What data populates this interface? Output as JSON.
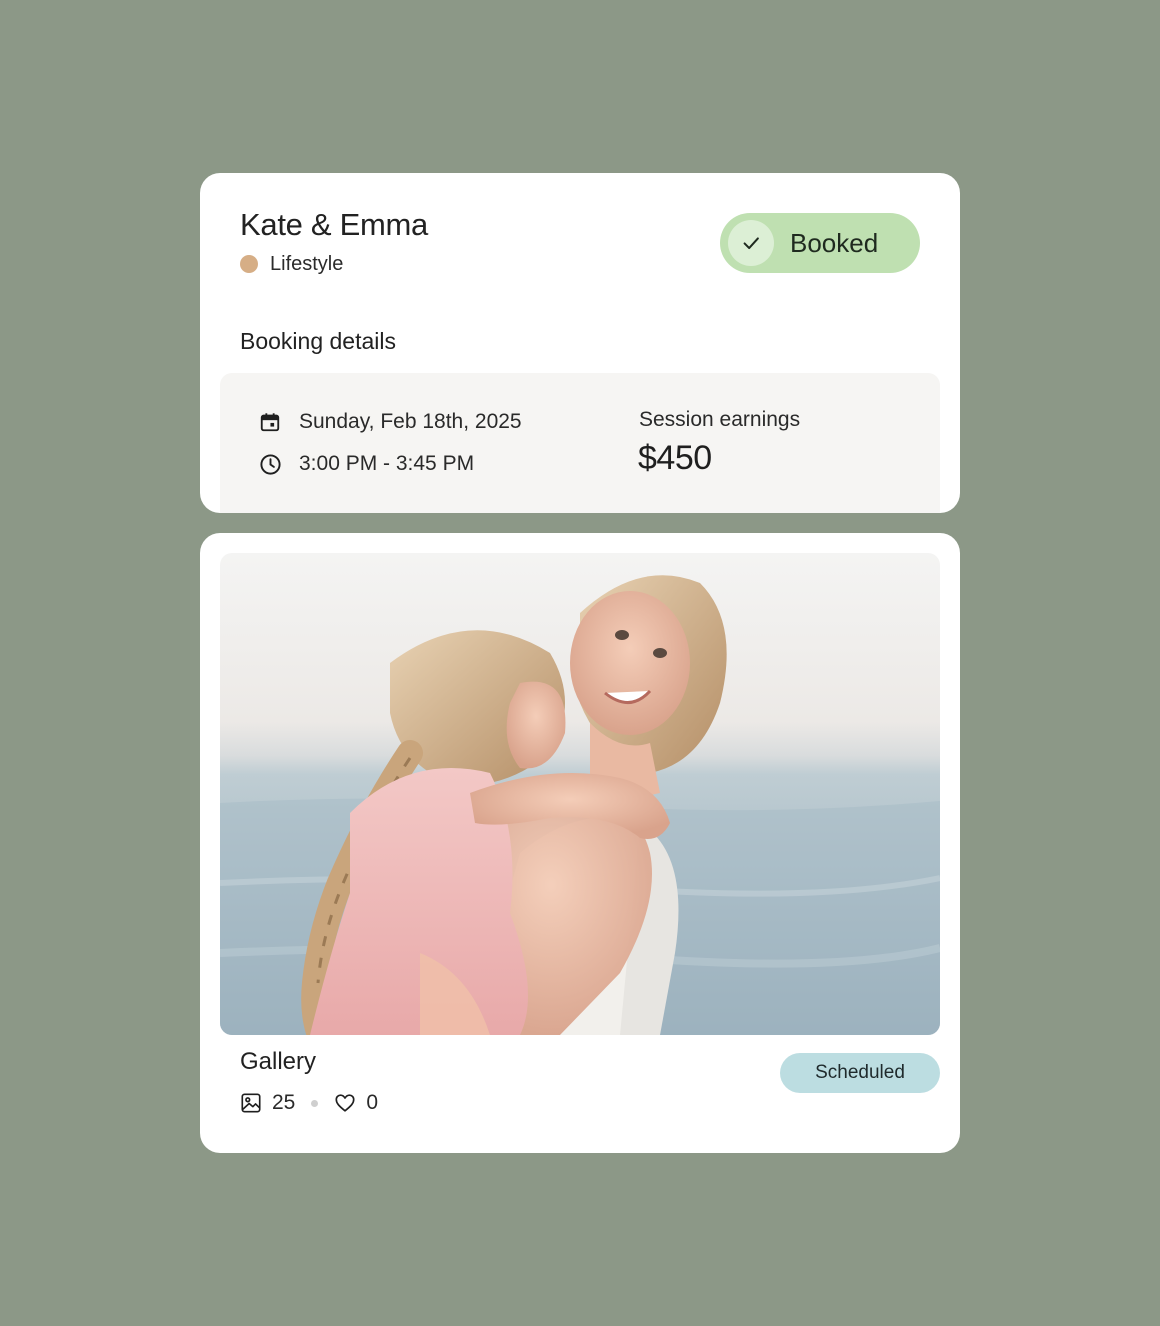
{
  "booking": {
    "client_name": "Kate & Emma",
    "category": {
      "label": "Lifestyle",
      "color": "#d6ae86"
    },
    "status": {
      "label": "Booked",
      "color": "#bfe0b1",
      "check_color": "#dcefd5",
      "icon": "check-icon"
    },
    "section_title": "Booking details",
    "date": {
      "icon": "calendar-icon",
      "text": "Sunday, Feb 18th, 2025"
    },
    "time": {
      "icon": "clock-icon",
      "text": "3:00 PM - 3:45 PM"
    },
    "earnings": {
      "label": "Session earnings",
      "value": "$450"
    }
  },
  "gallery": {
    "photo": {
      "description": "mother-and-daughter-hugging-by-the-sea"
    },
    "title": "Gallery",
    "photo_count": "25",
    "like_count": "0",
    "photo_icon": "image-icon",
    "like_icon": "heart-icon",
    "status": {
      "label": "Scheduled",
      "color": "#bcdde1"
    }
  }
}
